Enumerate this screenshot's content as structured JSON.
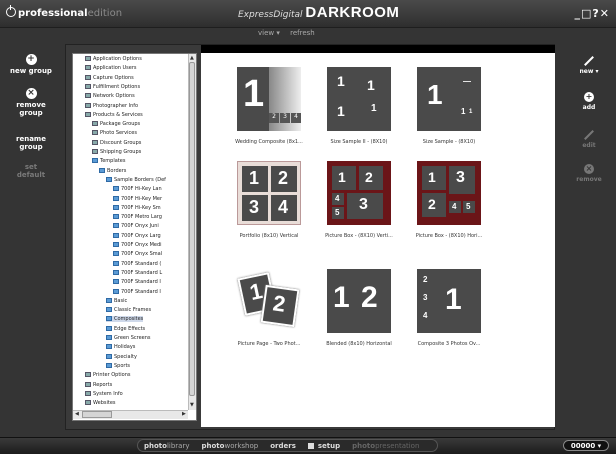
{
  "app": {
    "brand_bold": "professional",
    "brand_light": "edition",
    "logo_small": "ExpressDigital",
    "logo_big": "DARKROOM",
    "window_controls": "_□?✕"
  },
  "subnav": {
    "view": "view ▾",
    "refresh": "refresh"
  },
  "left_rail": {
    "new_group": "new group",
    "remove_group": "remove group",
    "rename_group": "rename group",
    "set_default": "set default"
  },
  "right_rail": {
    "new": "new ▾",
    "add": "add",
    "edit": "edit",
    "remove": "remove"
  },
  "tree": [
    "Application Options",
    "Application Users",
    "Capture Options",
    "Fulfillment Options",
    "Network Options",
    "Photographer Info",
    "Products & Services",
    "Package Groups",
    "Photo Services",
    "Discount Groups",
    "Shipping Groups",
    "Templates",
    "Borders",
    "Sample Borders (Def",
    "700F Hi-Key Lan",
    "700F Hi-Key Mer",
    "700F Hi-Key Sm",
    "700F Metro Larg",
    "700F Onyx Juni",
    "700F Onyx Larg",
    "700F Onyx Medi",
    "700F Onyx Smal",
    "700F Standard (",
    "700F Standard L",
    "700F Standard I",
    "700F Standard I",
    "Basic",
    "Classic Frames",
    "Composites",
    "Edge Effects",
    "Green Screens",
    "Holidays",
    "Specialty",
    "Sports",
    "Printer Options",
    "Reports",
    "System Info",
    "Websites"
  ],
  "thumbnails": [
    "Wedding Composite (8x1...",
    "Size Sample II - (8X10)",
    "Size Sample - (8X10)",
    "Portfolio (8x10) Vertical",
    "Picture Box - (8X10) Verti...",
    "Picture Box - (8X10) Hori...",
    "Picture Page - Two Phot...",
    "Blended (8x10) Horizontal",
    "Composite 3 Photos Ov..."
  ],
  "bottom_tabs": {
    "library_b": "photo",
    "library_l": "library",
    "workshop_b": "photo",
    "workshop_l": "workshop",
    "orders": "orders",
    "setup": "setup",
    "presentation_b": "photo",
    "presentation_l": "presentation"
  },
  "counter": "00000 ▾"
}
